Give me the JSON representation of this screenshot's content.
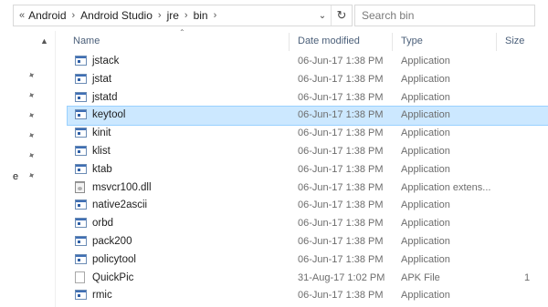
{
  "address_bar": {
    "overflow": "«",
    "segments": [
      "Android",
      "Android Studio",
      "jre",
      "bin"
    ],
    "dropdown_icon": "chevron-down-icon",
    "refresh_icon": "refresh-icon"
  },
  "search": {
    "placeholder": "Search bin"
  },
  "columns": {
    "name": "Name",
    "date": "Date modified",
    "type": "Type",
    "size": "Size"
  },
  "left_pane": {
    "label": "e"
  },
  "files": [
    {
      "name": "jstack",
      "date": "06-Jun-17 1:38 PM",
      "type": "Application",
      "size": "",
      "icon": "exe"
    },
    {
      "name": "jstat",
      "date": "06-Jun-17 1:38 PM",
      "type": "Application",
      "size": "",
      "icon": "exe"
    },
    {
      "name": "jstatd",
      "date": "06-Jun-17 1:38 PM",
      "type": "Application",
      "size": "",
      "icon": "exe"
    },
    {
      "name": "keytool",
      "date": "06-Jun-17 1:38 PM",
      "type": "Application",
      "size": "",
      "icon": "exe",
      "selected": true
    },
    {
      "name": "kinit",
      "date": "06-Jun-17 1:38 PM",
      "type": "Application",
      "size": "",
      "icon": "exe"
    },
    {
      "name": "klist",
      "date": "06-Jun-17 1:38 PM",
      "type": "Application",
      "size": "",
      "icon": "exe"
    },
    {
      "name": "ktab",
      "date": "06-Jun-17 1:38 PM",
      "type": "Application",
      "size": "",
      "icon": "exe"
    },
    {
      "name": "msvcr100.dll",
      "date": "06-Jun-17 1:38 PM",
      "type": "Application extens...",
      "size": "",
      "icon": "dll"
    },
    {
      "name": "native2ascii",
      "date": "06-Jun-17 1:38 PM",
      "type": "Application",
      "size": "",
      "icon": "exe"
    },
    {
      "name": "orbd",
      "date": "06-Jun-17 1:38 PM",
      "type": "Application",
      "size": "",
      "icon": "exe"
    },
    {
      "name": "pack200",
      "date": "06-Jun-17 1:38 PM",
      "type": "Application",
      "size": "",
      "icon": "exe"
    },
    {
      "name": "policytool",
      "date": "06-Jun-17 1:38 PM",
      "type": "Application",
      "size": "",
      "icon": "exe"
    },
    {
      "name": "QuickPic",
      "date": "31-Aug-17 1:02 PM",
      "type": "APK File",
      "size": "1",
      "icon": "apk"
    },
    {
      "name": "rmic",
      "date": "06-Jun-17 1:38 PM",
      "type": "Application",
      "size": "",
      "icon": "exe"
    }
  ],
  "colors": {
    "selection_bg": "#cce8ff",
    "selection_border": "#99d1ff",
    "header_text": "#4c607a"
  }
}
